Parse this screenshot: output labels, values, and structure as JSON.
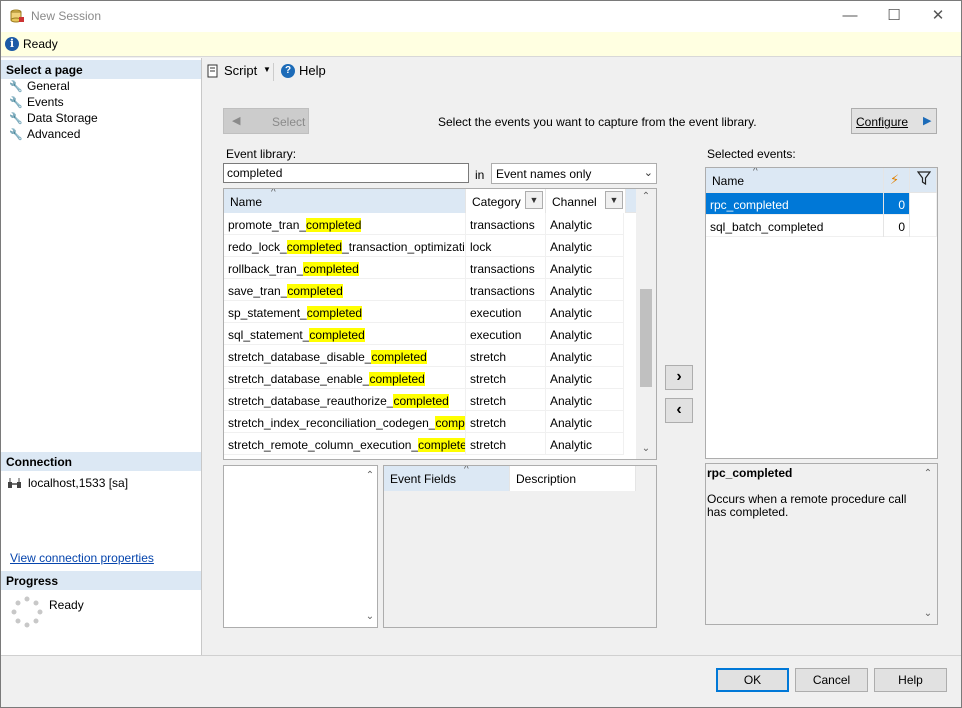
{
  "window": {
    "title": "New Session",
    "minimize_glyph": "—",
    "maximize_glyph": "☐",
    "close_glyph": "✕"
  },
  "status": {
    "text": "Ready",
    "icon": "info-icon"
  },
  "left": {
    "select_page_title": "Select a page",
    "pages": [
      {
        "label": "General",
        "icon": "wrench-icon"
      },
      {
        "label": "Events",
        "icon": "wrench-icon"
      },
      {
        "label": "Data Storage",
        "icon": "wrench-icon"
      },
      {
        "label": "Advanced",
        "icon": "wrench-icon"
      }
    ],
    "connection_title": "Connection",
    "connection_server": "localhost,1533 [sa]",
    "view_connection_link": "View connection properties",
    "progress_title": "Progress",
    "progress_status": "Ready"
  },
  "toolbar": {
    "script_label": "Script",
    "help_label": "Help"
  },
  "events_page": {
    "select_button": "Select",
    "instruction": "Select the events you want to capture from the event library.",
    "configure_button": "Configure",
    "event_library_label": "Event library:",
    "search_value": "completed",
    "in_label": "in",
    "filter_mode": "Event names only",
    "library_headers": [
      "Name",
      "Category",
      "Channel"
    ],
    "library_rows": [
      {
        "pre": "promote_tran_",
        "hit": "completed",
        "post": "",
        "category": "transactions",
        "channel": "Analytic"
      },
      {
        "pre": "redo_lock_",
        "hit": "completed",
        "post": "_transaction_optimization_...",
        "category": "lock",
        "channel": "Analytic"
      },
      {
        "pre": "rollback_tran_",
        "hit": "completed",
        "post": "",
        "category": "transactions",
        "channel": "Analytic"
      },
      {
        "pre": "save_tran_",
        "hit": "completed",
        "post": "",
        "category": "transactions",
        "channel": "Analytic"
      },
      {
        "pre": "sp_statement_",
        "hit": "completed",
        "post": "",
        "category": "execution",
        "channel": "Analytic"
      },
      {
        "pre": "sql_statement_",
        "hit": "completed",
        "post": "",
        "category": "execution",
        "channel": "Analytic"
      },
      {
        "pre": "stretch_database_disable_",
        "hit": "completed",
        "post": "",
        "category": "stretch",
        "channel": "Analytic"
      },
      {
        "pre": "stretch_database_enable_",
        "hit": "completed",
        "post": "",
        "category": "stretch",
        "channel": "Analytic"
      },
      {
        "pre": "stretch_database_reauthorize_",
        "hit": "completed",
        "post": "",
        "category": "stretch",
        "channel": "Analytic"
      },
      {
        "pre": "stretch_index_reconciliation_codegen_",
        "hit": "completed",
        "post": "",
        "category": "stretch",
        "channel": "Analytic"
      },
      {
        "pre": "stretch_remote_column_execution_",
        "hit": "completed",
        "post": "",
        "category": "stretch",
        "channel": "Analytic"
      }
    ],
    "add_glyph": "›",
    "remove_glyph": "‹",
    "fields_headers": [
      "Event Fields",
      "Description"
    ],
    "selected_label": "Selected events:",
    "selected_header": "Name",
    "selected_rows": [
      {
        "name": "rpc_completed",
        "count": "0",
        "selected": true
      },
      {
        "name": "sql_batch_completed",
        "count": "0",
        "selected": false
      }
    ],
    "detail_title": "rpc_completed",
    "detail_text": "Occurs when a remote procedure call has completed."
  },
  "buttons": {
    "ok": "OK",
    "cancel": "Cancel",
    "help": "Help"
  },
  "colors": {
    "accent": "#0078d7",
    "highlight": "#ffff00",
    "status_bg": "#ffffe1",
    "section_bg": "#dce8f4"
  }
}
